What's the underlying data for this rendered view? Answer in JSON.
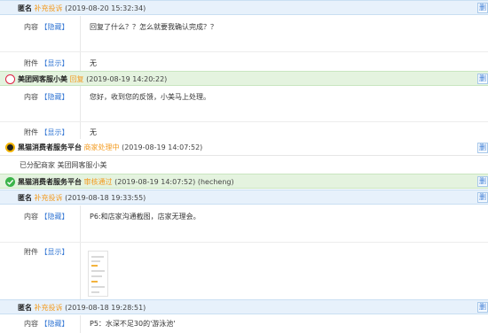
{
  "entries": [
    {
      "name": "匿名",
      "tag": "补充投诉",
      "time": "(2019-08-20 15:32:34)",
      "content_label": "内容",
      "content_link": "【隐藏】",
      "content": "回复了什么？？怎么就要我确认完成？？",
      "attach_label": "附件",
      "attach_link": "【显示】",
      "attach": "无",
      "delete": "删"
    },
    {
      "name": "美团网客服小美",
      "tag": "回复",
      "time": "(2019-08-19 14:20:22)",
      "content": "您好，收到您的反馈，小美马上处理。",
      "attach": "无"
    },
    {
      "name": "黑猫消费者服务平台",
      "tag": "商家处理中",
      "time": "(2019-08-19 14:07:52)",
      "note": "已分配商家 美团网客服小美"
    },
    {
      "name": "黑猫消费者服务平台",
      "tag": "审核通过",
      "time": "(2019-08-19 14:07:52) (hecheng)"
    },
    {
      "name": "匿名",
      "tag": "补充投诉",
      "time": "(2019-08-18 19:33:55)",
      "content": "P6:和店家沟通截图，店家无理会。"
    },
    {
      "name": "匿名",
      "tag": "补充投诉",
      "time": "(2019-08-18 19:28:51)",
      "content": "P5：水深不足30的'游泳池'"
    }
  ],
  "colors": {
    "accent": "#3a7bd5",
    "orange": "#f39a1e",
    "blue_bar": "#e7f1fb",
    "green_bar": "#e4f3df"
  }
}
